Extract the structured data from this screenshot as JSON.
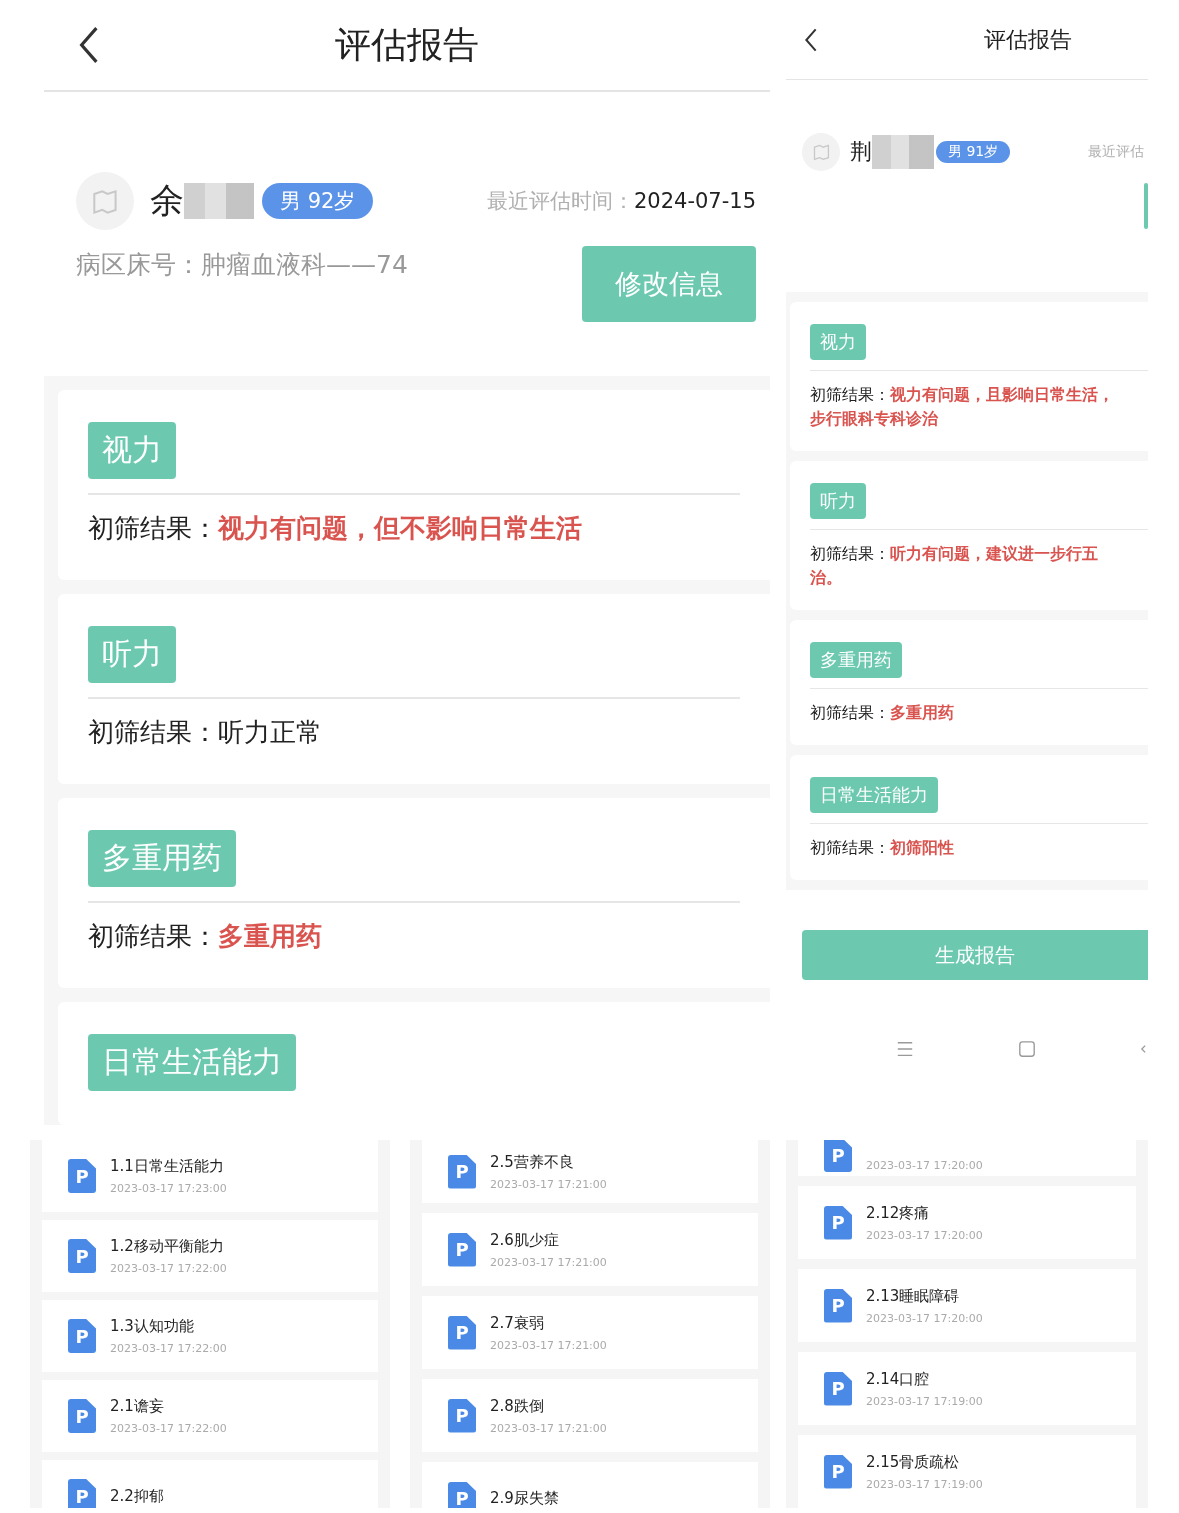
{
  "main_screen": {
    "title": "评估报告",
    "patient": {
      "name": "余",
      "gender_age": "男 92岁",
      "last_eval_label": "最近评估时间：",
      "last_eval_date": "2024-07-15",
      "ward_label": "病区床号：",
      "ward_value": "肿瘤血液科——74"
    },
    "edit_button": "修改信息",
    "items": [
      {
        "tag": "视力",
        "result_label": "初筛结果：",
        "result_lines": [
          "视力有问题，但不影响日常生活"
        ],
        "abnormal": true
      },
      {
        "tag": "听力",
        "result_label": "初筛结果：",
        "result_lines": [
          "听力正常"
        ],
        "abnormal": false
      },
      {
        "tag": "多重用药",
        "result_label": "初筛结果：",
        "result_lines": [
          "多重用药"
        ],
        "abnormal": true
      },
      {
        "tag": "日常生活能力"
      }
    ]
  },
  "side_screen": {
    "title": "评估报告",
    "patient": {
      "name": "荆",
      "gender_age": "男 91岁",
      "last_eval_label": "最近评估"
    },
    "items": [
      {
        "tag": "视力",
        "result_label": "初筛结果：",
        "result_lines": [
          "视力有问题，且影响日常生活，",
          "步行眼科专科诊治"
        ],
        "abnormal": true
      },
      {
        "tag": "听力",
        "result_label": "初筛结果：",
        "result_lines": [
          "听力有问题，建议进一步行五",
          "治。"
        ],
        "abnormal": true
      },
      {
        "tag": "多重用药",
        "result_label": "初筛结果：",
        "result_lines": [
          "多重用药"
        ],
        "abnormal": true
      },
      {
        "tag": "日常生活能力",
        "result_label": "初筛结果：",
        "result_lines": [
          "初筛阳性"
        ],
        "abnormal": true
      }
    ],
    "generate_button": "生成报告"
  },
  "file_lists": [
    {
      "items": [
        {
          "icon_letter": "P",
          "title": "1.1日常生活能力",
          "time": "2023-03-17 17:23:00"
        },
        {
          "icon_letter": "P",
          "title": "1.2移动平衡能力",
          "time": "2023-03-17 17:22:00"
        },
        {
          "icon_letter": "P",
          "title": "1.3认知功能",
          "time": "2023-03-17 17:22:00"
        },
        {
          "icon_letter": "P",
          "title": "2.1谵妄",
          "time": "2023-03-17 17:22:00"
        },
        {
          "icon_letter": "P",
          "title": "2.2抑郁"
        }
      ]
    },
    {
      "items": [
        {
          "icon_letter": "P",
          "title": "2.5营养不良",
          "time": "2023-03-17 17:21:00"
        },
        {
          "icon_letter": "P",
          "title": "2.6肌少症",
          "time": "2023-03-17 17:21:00"
        },
        {
          "icon_letter": "P",
          "title": "2.7衰弱",
          "time": "2023-03-17 17:21:00"
        },
        {
          "icon_letter": "P",
          "title": "2.8跌倒",
          "time": "2023-03-17 17:21:00"
        },
        {
          "icon_letter": "P",
          "title": "2.9尿失禁"
        }
      ]
    },
    {
      "items": [
        {
          "icon_letter": "P",
          "time": "2023-03-17 17:20:00"
        },
        {
          "icon_letter": "P",
          "title": "2.12疼痛",
          "time": "2023-03-17 17:20:00"
        },
        {
          "icon_letter": "P",
          "title": "2.13睡眠障碍",
          "time": "2023-03-17 17:20:00"
        },
        {
          "icon_letter": "P",
          "title": "2.14口腔",
          "time": "2023-03-17 17:19:00"
        },
        {
          "icon_letter": "P",
          "title": "2.15骨质疏松",
          "time": "2023-03-17 17:19:00"
        }
      ]
    }
  ]
}
